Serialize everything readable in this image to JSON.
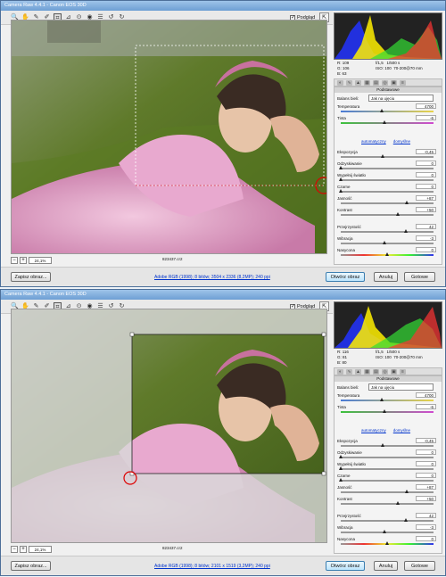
{
  "windows": [
    {
      "title": "Camera Raw 4.4.1  -  Canon EOS 30D",
      "preview_label": "Podgląd",
      "zoom": "24,1%",
      "filename": "823437.cr2",
      "workflow_link": "Adobe RGB (1998); 8 bitów; 3504 x 2336 (8,2MP); 240 ppi",
      "readout": {
        "r": "R: 109",
        "g": "G: 106",
        "b": "B: 63",
        "aperture": "f/1,5",
        "shutter": "1/500 s",
        "iso": "ISO: 100",
        "lens": "70-200@70 mm"
      }
    },
    {
      "title": "Camera Raw 4.4.1  -  Canon EOS 30D",
      "preview_label": "Podgląd",
      "zoom": "24,1%",
      "filename": "823437.cr2",
      "workflow_link": "Adobe RGB (1998); 8 bitów; 2101 x 1519 (3,2MP); 240 ppi",
      "readout": {
        "r": "R: 116",
        "g": "G: 81",
        "b": "B: 80",
        "aperture": "f/1,5",
        "shutter": "1/500 s",
        "iso": "ISO: 100",
        "lens": "70-200@70 mm"
      }
    }
  ],
  "buttons": {
    "save": "Zapisz obraz...",
    "open": "Otwórz obraz",
    "cancel": "Anuluj",
    "done": "Gotowe"
  },
  "panel": {
    "header": "Podstawowe",
    "wb_label": "Balans bieli:",
    "wb_value": "Jak na ujęciu",
    "auto": "automatyczny",
    "default": "domyślne",
    "sliders": [
      {
        "label": "Temperatura",
        "value": "4700",
        "pos": 0.45
      },
      {
        "label": "Tinta",
        "value": "-6",
        "pos": 0.48
      },
      {
        "label": "Ekspozycja",
        "value": "-0,45",
        "pos": 0.46
      },
      {
        "label": "Odzyskiwanie",
        "value": "0",
        "pos": 0.0
      },
      {
        "label": "Wypełnij światło",
        "value": "0",
        "pos": 0.0
      },
      {
        "label": "Czarne",
        "value": "0",
        "pos": 0.0
      },
      {
        "label": "Jasność",
        "value": "+87",
        "pos": 0.72
      },
      {
        "label": "Kontrast",
        "value": "+50",
        "pos": 0.62
      },
      {
        "label": "Przejrzystość",
        "value": "42",
        "pos": 0.71
      },
      {
        "label": "Wibracja",
        "value": "-3",
        "pos": 0.48
      },
      {
        "label": "Nasycona",
        "value": "0",
        "pos": 0.5
      }
    ]
  }
}
